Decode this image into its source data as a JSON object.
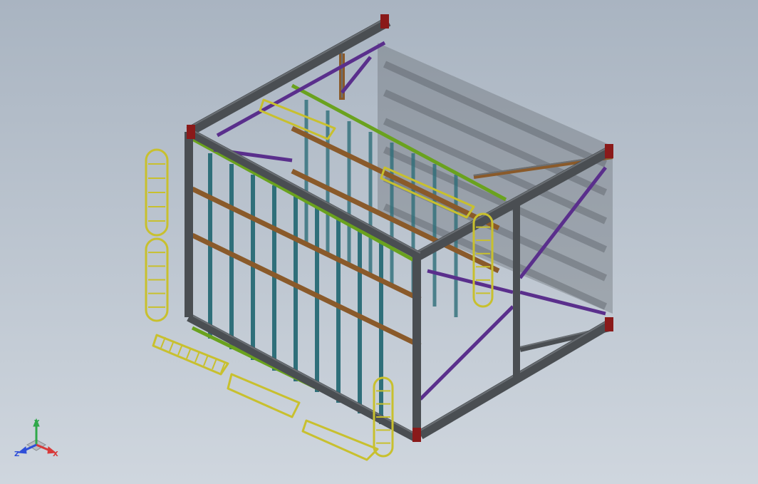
{
  "viewport": {
    "background_top": "#a9b4c1",
    "background_bottom": "#cfd6de"
  },
  "model": {
    "colors": {
      "main_beam": "#4a4e52",
      "main_beam_light": "#6a6f74",
      "end_plate": "#8a1a1a",
      "brace": "#5a2f8c",
      "stud": "#2f6f7a",
      "waler": "#8a5a2a",
      "top_rail": "#6aa21e",
      "ladder_cage": "#c8c02e",
      "shadow": "#5f646b"
    }
  },
  "triad": {
    "x_label": "X",
    "y_label": "Y",
    "z_label": "Z",
    "x_color": "#d83a3a",
    "y_color": "#2fa84a",
    "z_color": "#2f4fd8"
  }
}
